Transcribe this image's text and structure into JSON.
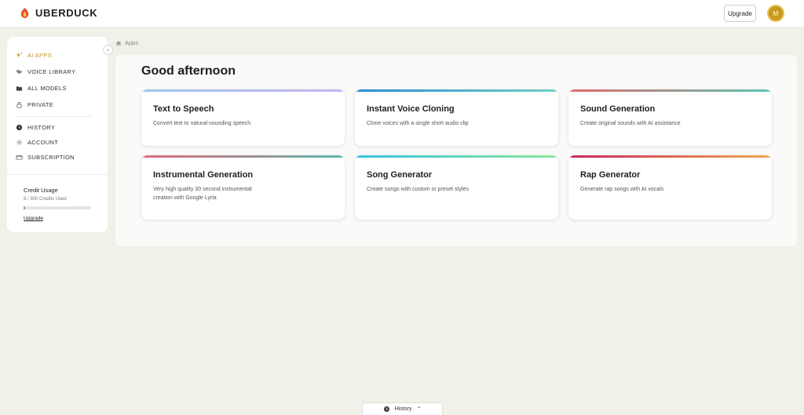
{
  "header": {
    "brand": "UBERDUCK",
    "upgrade_label": "Upgrade",
    "avatar_initial": "M"
  },
  "colors": {
    "accent": "#c4962a",
    "avatar": "#c89a1e",
    "background": "#f1f0e9"
  },
  "sidebar": {
    "items": [
      {
        "label": "AI APPS",
        "icon": "sparkle-icon"
      },
      {
        "label": "VOICE LIBRARY",
        "icon": "waveform-icon"
      },
      {
        "label": "ALL MODELS",
        "icon": "folder-icon"
      },
      {
        "label": "PRIVATE",
        "icon": "lock-icon"
      },
      {
        "label": "HISTORY",
        "icon": "clock-icon"
      },
      {
        "label": "ACCOUNT",
        "icon": "gear-icon"
      },
      {
        "label": "SUBSCRIPTION",
        "icon": "card-icon"
      }
    ],
    "credit": {
      "title": "Credit Usage",
      "used_text": "6 / 300 Credits Used",
      "used_fraction": 0.02,
      "upgrade_link": "Upgrade"
    }
  },
  "breadcrumb": {
    "label": "Apps"
  },
  "main": {
    "greeting": "Good afternoon",
    "cards": [
      {
        "title": "Text to Speech",
        "desc": "Convert text to natural-sounding speech",
        "gradient": [
          "#9ec5ef",
          "#c9b6f2"
        ]
      },
      {
        "title": "Instant Voice Cloning",
        "desc": "Clone voices with a single short audio clip",
        "gradient": [
          "#2a8cd6",
          "#6fd0c4"
        ]
      },
      {
        "title": "Sound Generation",
        "desc": "Create original sounds with AI assistance",
        "gradient": [
          "#e06a6a",
          "#5cc4b6"
        ]
      },
      {
        "title": "Instrumental Generation",
        "desc": "Very high quality 30 second instrumental creation with Google Lyria",
        "gradient": [
          "#e2687b",
          "#5fb8ad"
        ]
      },
      {
        "title": "Song Generator",
        "desc": "Create songs with custom or preset styles",
        "gradient": [
          "#35c2e2",
          "#8ce89a"
        ]
      },
      {
        "title": "Rap Generator",
        "desc": "Generate rap songs with AI vocals",
        "gradient": [
          "#c9275e",
          "#f0a850"
        ]
      }
    ]
  },
  "bottom_tab": {
    "label": "History"
  }
}
